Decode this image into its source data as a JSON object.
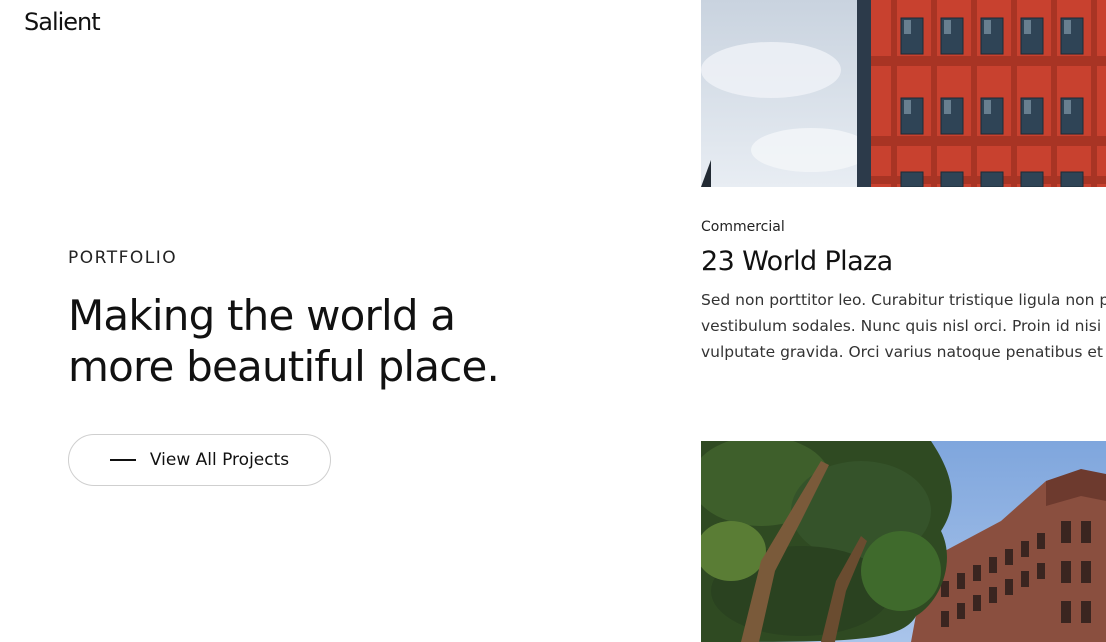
{
  "brand": {
    "logo_text": "Salient"
  },
  "hero": {
    "eyebrow": "PORTFOLIO",
    "headline_line1": "Making the world a",
    "headline_line2": "more beautiful place.",
    "cta_label": "View All Projects"
  },
  "project": {
    "category": "Commercial",
    "title": "23 World Plaza",
    "description_line1": "Sed non porttitor leo. Curabitur tristique ligula non p",
    "description_line2": "vestibulum sodales. Nunc quis nisl orci. Proin id nisi",
    "description_line3": "vulputate gravida. Orci varius natoque penatibus et n"
  },
  "colors": {
    "text": "#111111",
    "cta_border": "#cfcfcf",
    "building_red": "#c8412f",
    "sky_blue": "#8fb4e6"
  },
  "images": {
    "top": "red-brick-building-photo",
    "bottom": "flatiron-building-with-tree-photo"
  }
}
